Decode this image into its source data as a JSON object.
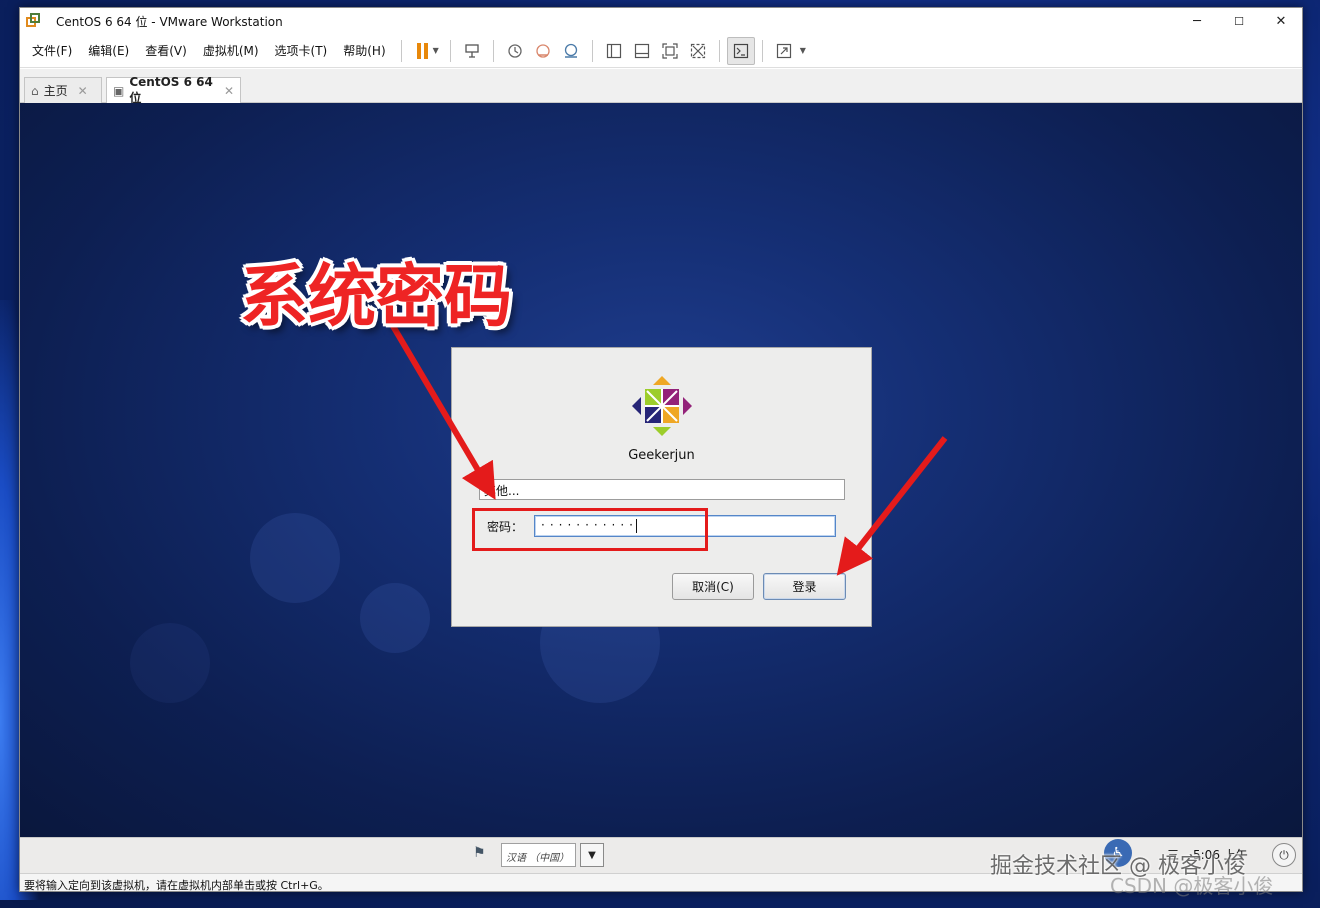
{
  "window": {
    "title": "CentOS 6 64 位 - VMware Workstation",
    "controls": {
      "minimize": "─",
      "maximize": "☐",
      "close": "✕"
    }
  },
  "menu": [
    "文件(F)",
    "编辑(E)",
    "查看(V)",
    "虚拟机(M)",
    "选项卡(T)",
    "帮助(H)"
  ],
  "tabs": [
    {
      "label": "主页",
      "icon": "home-icon"
    },
    {
      "label": "CentOS 6 64 位",
      "icon": "vm-icon",
      "active": true
    }
  ],
  "annotation": {
    "callout": "系统密码",
    "color": "#ee2424"
  },
  "login": {
    "username": "Geekerjun",
    "other_field": "其他...",
    "password_label": "密码：",
    "password_value": "···········",
    "cancel_button": "取消(C)",
    "login_button": "登录"
  },
  "guest_panel": {
    "language": "汉语 （中国）",
    "day": "三",
    "time": "5:06 上午"
  },
  "status_text": "要将输入定向到该虚拟机，请在虚拟机内部单击或按 Ctrl+G。",
  "watermark": {
    "line1": "掘金技术社区 @ 极客小俊",
    "line2": "CSDN @极客小俊"
  }
}
